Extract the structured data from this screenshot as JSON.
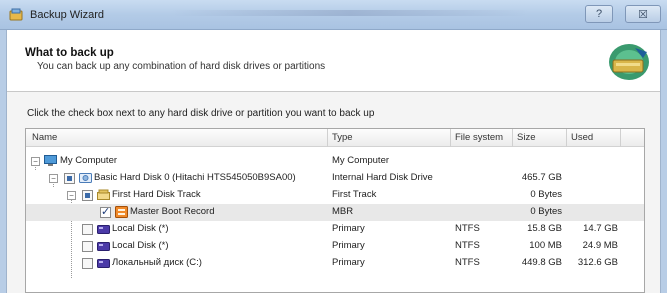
{
  "window": {
    "title": "Backup Wizard",
    "help_label": "?",
    "close_label": "☒"
  },
  "header": {
    "title": "What to back up",
    "subtitle": "You can back up any combination of hard disk drives or partitions"
  },
  "instruction": "Click the check box next to any hard disk drive or partition you want to back up",
  "columns": {
    "name": "Name",
    "type": "Type",
    "fs": "File system",
    "size": "Size",
    "used": "Used"
  },
  "rows": [
    {
      "name": "My Computer",
      "type": "My Computer",
      "fs": "",
      "size": "",
      "used": "",
      "icon": "computer-icon"
    },
    {
      "name": "Basic Hard Disk 0 (Hitachi HTS545050B9SA00)",
      "type": "Internal Hard Disk Drive",
      "fs": "",
      "size": "465.7 GB",
      "used": "",
      "icon": "hard-disk-icon"
    },
    {
      "name": "First Hard Disk Track",
      "type": "First Track",
      "fs": "",
      "size": "0 Bytes",
      "used": "",
      "icon": "disk-track-icon"
    },
    {
      "name": "Master Boot Record",
      "type": "MBR",
      "fs": "",
      "size": "0 Bytes",
      "used": "",
      "icon": "mbr-icon"
    },
    {
      "name": "Local Disk (*)",
      "type": "Primary",
      "fs": "NTFS",
      "size": "15.8 GB",
      "used": "14.7 GB",
      "icon": "partition-icon"
    },
    {
      "name": "Local Disk (*)",
      "type": "Primary",
      "fs": "NTFS",
      "size": "100 MB",
      "used": "24.9 MB",
      "icon": "partition-icon"
    },
    {
      "name": "Локальный диск (C:)",
      "type": "Primary",
      "fs": "NTFS",
      "size": "449.8 GB",
      "used": "312.6 GB",
      "icon": "partition-icon"
    }
  ],
  "colors": {
    "accent": "#3b6aa8",
    "titlebar": "#b3cbe7",
    "selection": "#e8e8e8"
  }
}
